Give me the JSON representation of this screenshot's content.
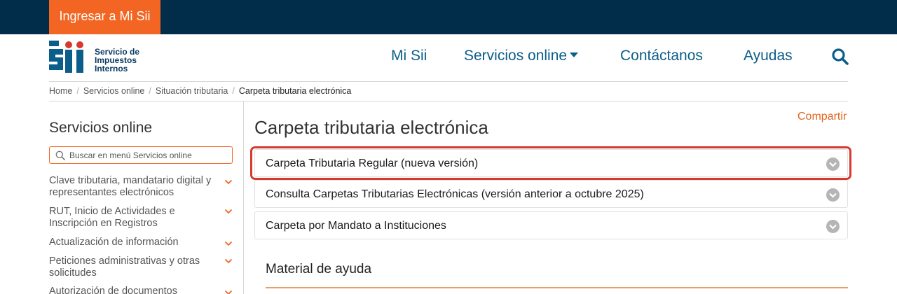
{
  "topbar": {
    "login_label": "Ingresar a Mi Sii"
  },
  "logo": {
    "line1": "Servicio de",
    "line2": "Impuestos",
    "line3": "Internos",
    "color": "#0b5e89"
  },
  "nav": {
    "items": [
      {
        "label": "Mi Sii"
      },
      {
        "label": "Servicios online"
      },
      {
        "label": "Contáctanos"
      },
      {
        "label": "Ayudas"
      }
    ],
    "search_icon": "search-icon"
  },
  "breadcrumb": [
    "Home",
    "Servicios online",
    "Situación tributaria",
    "Carpeta tributaria electrónica"
  ],
  "sidebar": {
    "title": "Servicios online",
    "search_placeholder": "Buscar en menú Servicios online",
    "items": [
      {
        "label": "Clave tributaria, mandatario digital y representantes electrónicos"
      },
      {
        "label": "RUT, Inicio de Actividades e Inscripción en Registros"
      },
      {
        "label": "Actualización de información"
      },
      {
        "label": "Peticiones administrativas y otras solicitudes"
      },
      {
        "label": "Autorización de documentos"
      }
    ]
  },
  "main": {
    "share_label": "Compartir",
    "title": "Carpeta tributaria electrónica",
    "accordions": [
      {
        "label": "Carpeta Tributaria Regular (nueva versión)",
        "highlighted": true
      },
      {
        "label": "Consulta Carpetas Tributarias Electrónicas (versión anterior a octubre 2025)"
      },
      {
        "label": "Carpeta por Mandato a Instituciones"
      }
    ],
    "help_title": "Material de ayuda"
  },
  "colors": {
    "topbar": "#012c4a",
    "accent": "#f26522",
    "nav_link": "#0b5e89",
    "highlight": "#d63a2f"
  }
}
